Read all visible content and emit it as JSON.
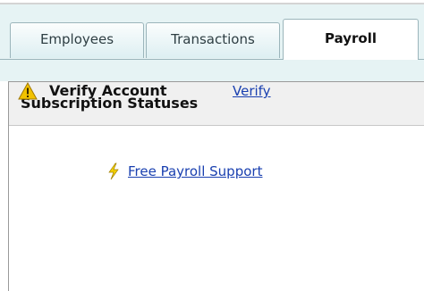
{
  "tabs": [
    {
      "label": "Employees",
      "active": false
    },
    {
      "label": "Transactions",
      "active": false
    },
    {
      "label": "Payroll",
      "active": true
    }
  ],
  "panel": {
    "title": "Subscription Statuses",
    "status_label": "Verify Account",
    "status_link": "Verify",
    "support_link": "Free Payroll Support"
  },
  "colors": {
    "tabstrip_bg": "#e6f3f4",
    "link": "#1a40b0",
    "warning": "#f2c200"
  },
  "icons": {
    "status": "warning-icon",
    "support": "lightning-bolt-icon"
  }
}
